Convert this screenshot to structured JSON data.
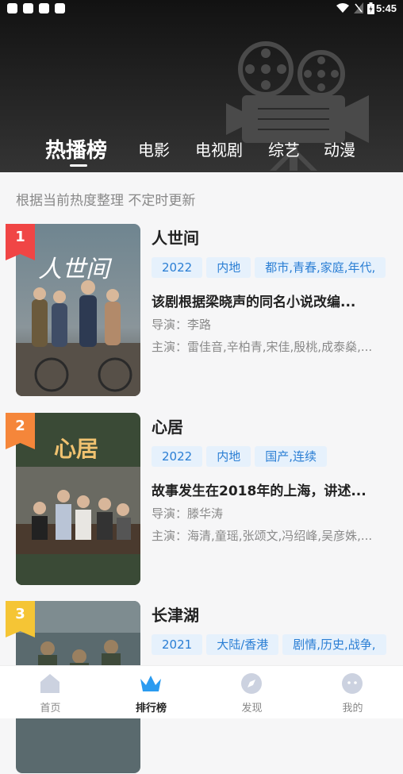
{
  "statusbar": {
    "time": "5:45"
  },
  "tabs": [
    {
      "label": "热播榜",
      "active": true
    },
    {
      "label": "电影"
    },
    {
      "label": "电视剧"
    },
    {
      "label": "综艺"
    },
    {
      "label": "动漫"
    }
  ],
  "subtitle": "根据当前热度整理 不定时更新",
  "items": [
    {
      "rank": "1",
      "title": "人世间",
      "poster_text": "人世间",
      "tags": [
        "2022",
        "内地",
        "都市,青春,家庭,年代,"
      ],
      "desc": "该剧根据梁晓声的同名小说改编...",
      "director": "导演：李路",
      "cast": "主演：雷佳音,辛柏青,宋佳,殷桃,成泰燊,..."
    },
    {
      "rank": "2",
      "title": "心居",
      "poster_text": "心居",
      "tags": [
        "2022",
        "内地",
        "国产,连续"
      ],
      "desc": "故事发生在2018年的上海，讲述...",
      "director": "导演：滕华涛",
      "cast": "主演：海清,童瑶,张颂文,冯绍峰,吴彦姝,..."
    },
    {
      "rank": "3",
      "title": "长津湖",
      "poster_text": "",
      "tags": [
        "2021",
        "大陆/香港",
        "剧情,历史,战争,"
      ],
      "desc": "",
      "director": "",
      "cast": ""
    }
  ],
  "nav": [
    {
      "label": "首页",
      "icon": "home-icon"
    },
    {
      "label": "排行榜",
      "icon": "crown-icon",
      "active": true
    },
    {
      "label": "发现",
      "icon": "compass-icon"
    },
    {
      "label": "我的",
      "icon": "profile-icon"
    }
  ],
  "colors": {
    "rank1": "#f04545",
    "rank2": "#f5863a",
    "rank3": "#f5c535",
    "tag_bg": "#e6f1fc",
    "tag_text": "#2a7ed4",
    "nav_active": "#2a9bf0"
  }
}
